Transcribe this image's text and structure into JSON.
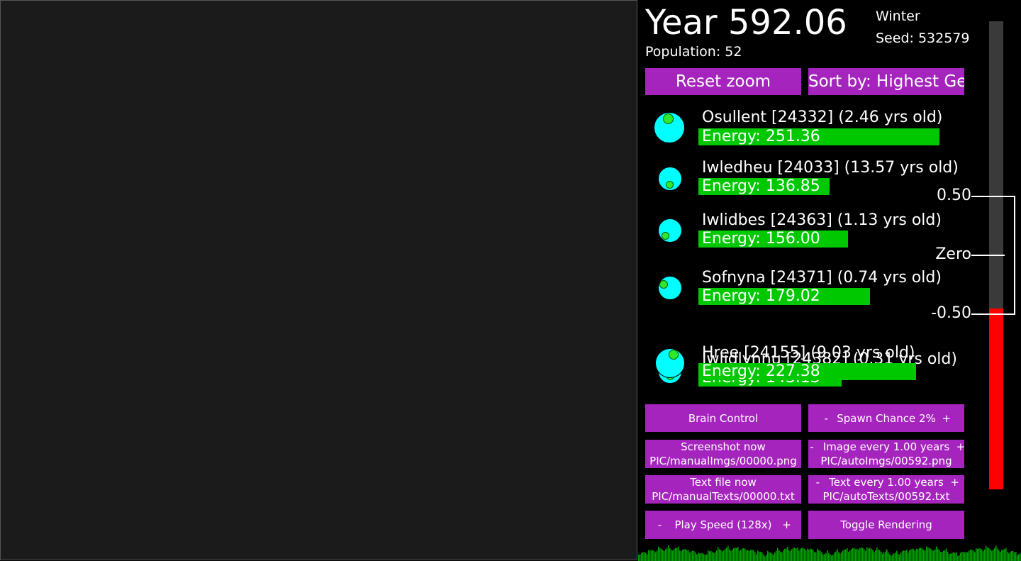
{
  "header": {
    "year": "Year 592.06",
    "season": "Winter",
    "seed": "Seed: 532579",
    "population": "Population: 52"
  },
  "controls": {
    "reset_zoom": "Reset zoom",
    "sort_by": "Sort by: Highest Gen"
  },
  "creatures": [
    {
      "name": "Osullent [24332] (2.46 yrs old)",
      "energy": "Energy: 251.36"
    },
    {
      "name": "Iwledheu [24033] (13.57 yrs old)",
      "energy": "Energy: 136.85"
    },
    {
      "name": "Iwlidbes [24363] (1.13 yrs old)",
      "energy": "Energy: 156.00"
    },
    {
      "name": "Sofnyna [24371] (0.74 yrs old)",
      "energy": "Energy: 179.02"
    },
    {
      "name": "Hree [24155] (9.03 yrs old)",
      "energy": "Energy: 227.38"
    },
    {
      "name": "Iwlidlynnu [24382] (0.31 yrs old)",
      "energy": "Energy: 143.13"
    }
  ],
  "buttons": {
    "brain_control": "Brain Control",
    "spawn_minus": "-",
    "spawn_label": "Spawn Chance 2%",
    "spawn_plus": "+",
    "screenshot_line1": "Screenshot now",
    "screenshot_line2": "PIC/manualImgs/00000.png",
    "image_minus": "-",
    "image_label": "Image every 1.00 years",
    "image_plus": "+",
    "image_line2": "PIC/autoImgs/00592.png",
    "textfile_line1": "Text file now",
    "textfile_line2": "PIC/manualTexts/00000.txt",
    "text_minus": "-",
    "text_label": "Text every 1.00 years",
    "text_plus": "+",
    "text_line2": "PIC/autoTexts/00592.txt",
    "speed_minus": "-",
    "speed_label": "Play Speed (128x)",
    "speed_plus": "+",
    "toggle_rendering": "Toggle Rendering"
  },
  "scale": {
    "top": "0.50",
    "zero": "Zero",
    "bottom": "-0.50"
  },
  "meter": {
    "track_color": "#3a3a3a",
    "fill_color": "#ff0000"
  },
  "colors": {
    "button": "#a524bd",
    "energy_bar": "#00c800",
    "creature_body": "#00ffff",
    "world_bg": "#1b1b1b"
  }
}
